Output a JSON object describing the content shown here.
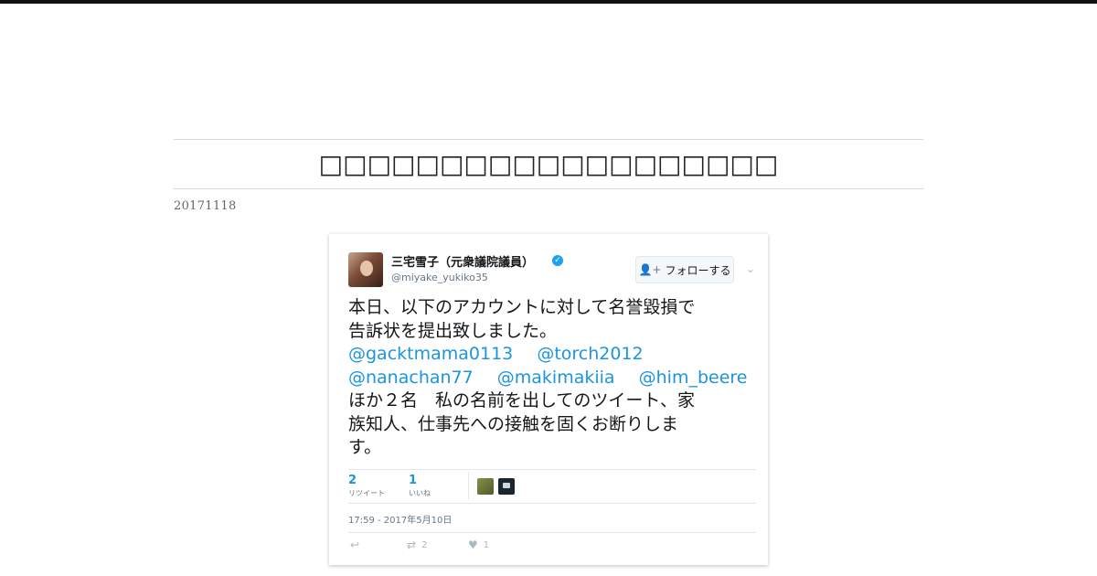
{
  "page": {
    "title": "□□□□□□□□□□□□□□□□□□□",
    "date": "20171118"
  },
  "tweet": {
    "display_name": "三宅雪子（元衆議院議員）",
    "handle": "@miyake_yukiko35",
    "follow_label": "フォローする",
    "body_lines": [
      "本日、以下のアカウントに対して名誉毀損で",
      "告訴状を提出致しました。"
    ],
    "mentions_line1": [
      "@gacktmama0113",
      "@torch2012"
    ],
    "mentions_line2": [
      "@nanachan77",
      "@makimakiia",
      "@him_beere"
    ],
    "body_tail_lines": [
      "ほか２名　私の名前を出してのツイート、家",
      "族知人、仕事先への接触を固くお断りしま",
      "す。"
    ],
    "retweets": {
      "count": "2",
      "label": "リツイート"
    },
    "likes": {
      "count": "1",
      "label": "いいね"
    },
    "timestamp": "17:59 - 2017年5月10日",
    "action_counts": {
      "retweet": "2",
      "like": "1"
    }
  },
  "colors": {
    "link": "#1b95e0",
    "verified": "#1da1f2",
    "topbar": "#111111"
  },
  "icons": {
    "verified": "verified-badge-icon",
    "follow": "person-add-icon",
    "caret": "chevron-down-icon",
    "reply": "reply-icon",
    "retweet": "retweet-icon",
    "like": "heart-icon"
  }
}
